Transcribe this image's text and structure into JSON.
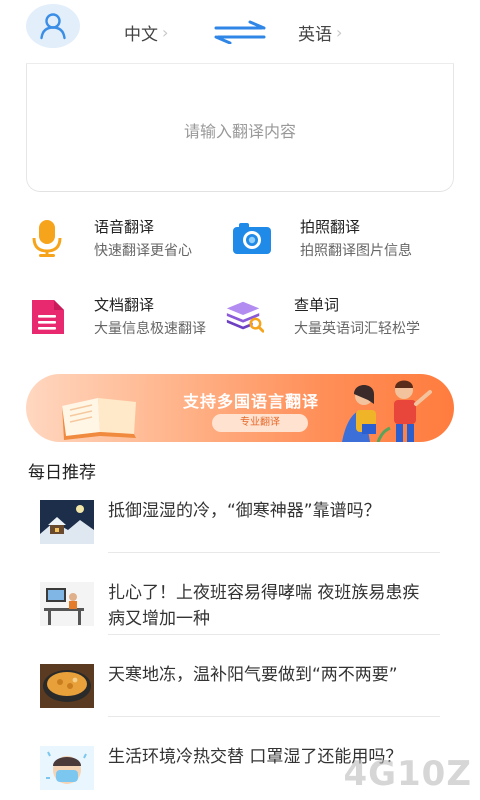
{
  "header": {
    "source_lang": "中文",
    "target_lang": "英语"
  },
  "input": {
    "placeholder": "请输入翻译内容"
  },
  "features": [
    {
      "title": "语音翻译",
      "desc": "快速翻译更省心",
      "icon": "microphone-icon"
    },
    {
      "title": "拍照翻译",
      "desc": "拍照翻译图片信息",
      "icon": "camera-icon"
    },
    {
      "title": "文档翻译",
      "desc": "大量信息极速翻译",
      "icon": "document-icon"
    },
    {
      "title": "查单词",
      "desc": "大量英语词汇轻松学",
      "icon": "books-search-icon"
    }
  ],
  "banner": {
    "title": "支持多国语言翻译",
    "button": "专业翻译"
  },
  "daily": {
    "title": "每日推荐",
    "articles": [
      {
        "title": "抵御湿湿的冷，“御寒神器”靠谱吗？"
      },
      {
        "title": "扎心了！上夜班容易得哮喘 夜班族易患疾病又增加一种"
      },
      {
        "title": "天寒地冻，温补阳气要做到“两不两要”"
      },
      {
        "title": "生活环境冷热交替 口罩湿了还能用吗？"
      }
    ]
  },
  "watermark": "4G10Z",
  "colors": {
    "accent_blue": "#2f86e6",
    "mic_orange": "#f7a41d",
    "doc_pink": "#e8286f",
    "books_purple": "#8a5ad8",
    "banner_orange": "#ff8e57"
  }
}
